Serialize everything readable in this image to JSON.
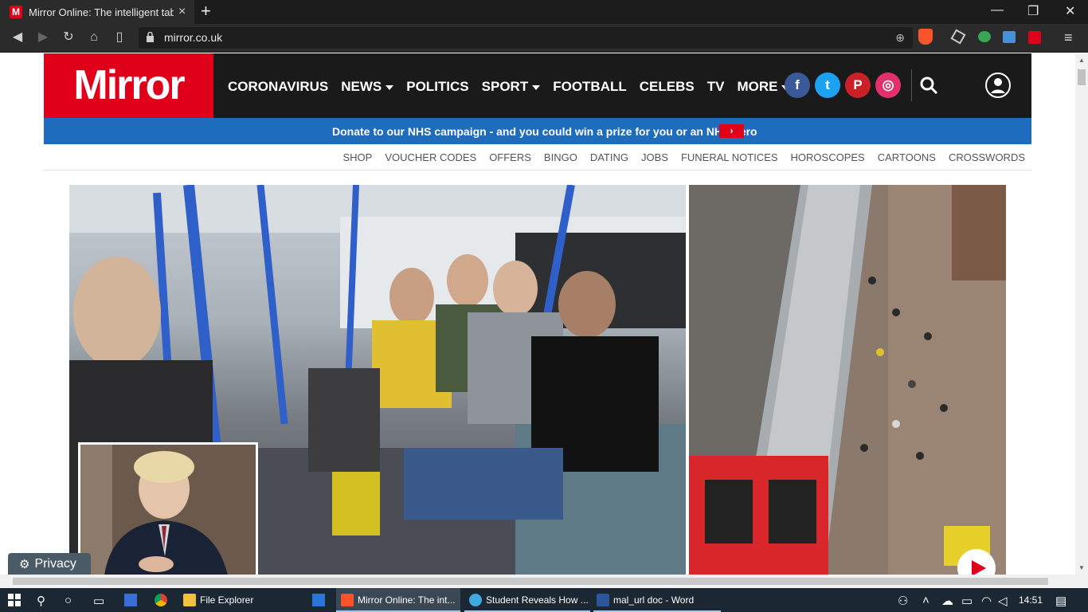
{
  "browser": {
    "tab_title": "Mirror Online: The intelligent tablo",
    "tab_close": "×",
    "new_tab": "+",
    "url": "mirror.co.uk",
    "window_controls": [
      "minimize-icon",
      "restore-icon",
      "close-icon"
    ]
  },
  "site": {
    "logo": "Mirror",
    "nav": [
      {
        "label": "CORONAVIRUS",
        "dropdown": false
      },
      {
        "label": "NEWS",
        "dropdown": true
      },
      {
        "label": "POLITICS",
        "dropdown": false
      },
      {
        "label": "SPORT",
        "dropdown": true
      },
      {
        "label": "FOOTBALL",
        "dropdown": false
      },
      {
        "label": "CELEBS",
        "dropdown": false
      },
      {
        "label": "TV",
        "dropdown": false
      },
      {
        "label": "MORE",
        "dropdown": true
      }
    ],
    "social": [
      {
        "icon": "facebook-icon",
        "glyph": "f",
        "color": "#3b5998"
      },
      {
        "icon": "twitter-icon",
        "glyph": "t",
        "color": "#1da1f2"
      },
      {
        "icon": "pinterest-icon",
        "glyph": "P",
        "color": "#cb2027"
      },
      {
        "icon": "instagram-icon",
        "glyph": "◎",
        "color": "#e1306c"
      }
    ],
    "banner_text": "Donate to our NHS campaign - and you could win a prize for you or an NHS hero",
    "banner_arrow": "›",
    "subnav": [
      "SHOP",
      "VOUCHER CODES",
      "OFFERS",
      "BINGO",
      "DATING",
      "JOBS",
      "FUNERAL NOTICES",
      "HOROSCOPES",
      "CARTOONS",
      "CROSSWORDS"
    ],
    "privacy_label": "Privacy"
  },
  "taskbar": {
    "apps": [
      {
        "label": "File Explorer",
        "icon": "folder-icon",
        "color": "#f0c040",
        "active": false
      },
      {
        "label": "Mirror Online: The int...",
        "icon": "brave-icon",
        "color": "#fb542b",
        "active": true
      },
      {
        "label": "Student Reveals How ...",
        "icon": "edge-icon",
        "color": "#3fa9e0",
        "active": false
      },
      {
        "label": "mal_url doc - Word",
        "icon": "word-icon",
        "color": "#2b579a",
        "active": false
      }
    ],
    "clock": "14:51"
  }
}
